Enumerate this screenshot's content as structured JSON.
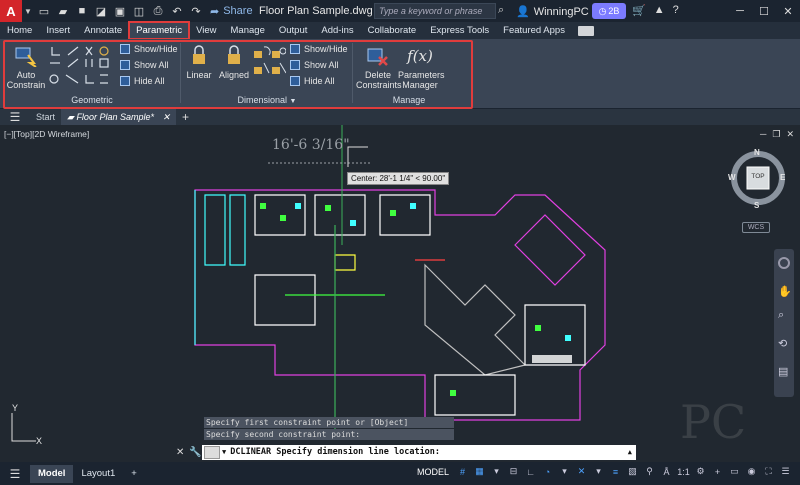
{
  "titlebar": {
    "logo": "A",
    "share_label": "Share",
    "document_title": "Floor Plan Sample.dwg -",
    "search_placeholder": "Type a keyword or phrase",
    "user_name": "WinningPC",
    "badge_label": "2B"
  },
  "ribbon_tabs": [
    "Home",
    "Insert",
    "Annotate",
    "Parametric",
    "View",
    "Manage",
    "Output",
    "Add-ins",
    "Collaborate",
    "Express Tools",
    "Featured Apps"
  ],
  "active_tab": "Parametric",
  "ribbon": {
    "auto_constrain": {
      "line1": "Auto",
      "line2": "Constrain"
    },
    "geometric": {
      "title": "Geometric",
      "show_hide": "Show/Hide",
      "show_all": "Show All",
      "hide_all": "Hide All"
    },
    "dimensional": {
      "title": "Dimensional",
      "linear": "Linear",
      "aligned": "Aligned",
      "show_hide": "Show/Hide",
      "show_all": "Show All",
      "hide_all": "Hide All"
    },
    "manage": {
      "title": "Manage",
      "delete_line1": "Delete",
      "delete_line2": "Constraints",
      "params_line1": "Parameters",
      "params_line2": "Manager"
    }
  },
  "doc_tabs": {
    "start": "Start",
    "active": "Floor Plan Sample*"
  },
  "viewport": {
    "label": "[−][Top][2D Wireframe]",
    "dimension_text": "16'-6 3/16\"",
    "tooltip": "Center: 28'-1 1/4\" < 90.00\"",
    "viewcube_top": "TOP",
    "compass": {
      "n": "N",
      "s": "S",
      "e": "E",
      "w": "W"
    },
    "wcs": "WCS",
    "watermark": "PC",
    "axis_y": "Y",
    "axis_x": "X"
  },
  "command": {
    "history1": "Specify first constraint point or [Object] <Object>:",
    "history2": "Specify second constraint point:",
    "current": "DCLINEAR Specify dimension line location:"
  },
  "statusbar": {
    "tabs": [
      "Model",
      "Layout1"
    ],
    "model_label": "MODEL",
    "scale": "1:1"
  },
  "colors": {
    "accent": "#e03c3c",
    "ribbon_bg": "#3a4555",
    "canvas_bg": "#212830"
  }
}
